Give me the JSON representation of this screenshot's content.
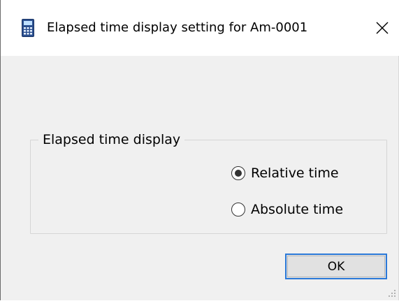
{
  "window": {
    "title": "Elapsed time display setting for Am-0001",
    "app_icon": "calculator-icon",
    "close_icon": "close-icon",
    "close_glyph": "✕"
  },
  "group": {
    "label": "Elapsed time display",
    "options": [
      {
        "label": "Relative time",
        "selected": true
      },
      {
        "label": "Absolute time",
        "selected": false
      }
    ]
  },
  "buttons": {
    "ok_label": "OK"
  },
  "colors": {
    "focus_border": "#2b79d8",
    "dialog_background": "#f0f0f0",
    "titlebar_background": "#ffffff",
    "icon_blue": "#2b4f8f"
  }
}
